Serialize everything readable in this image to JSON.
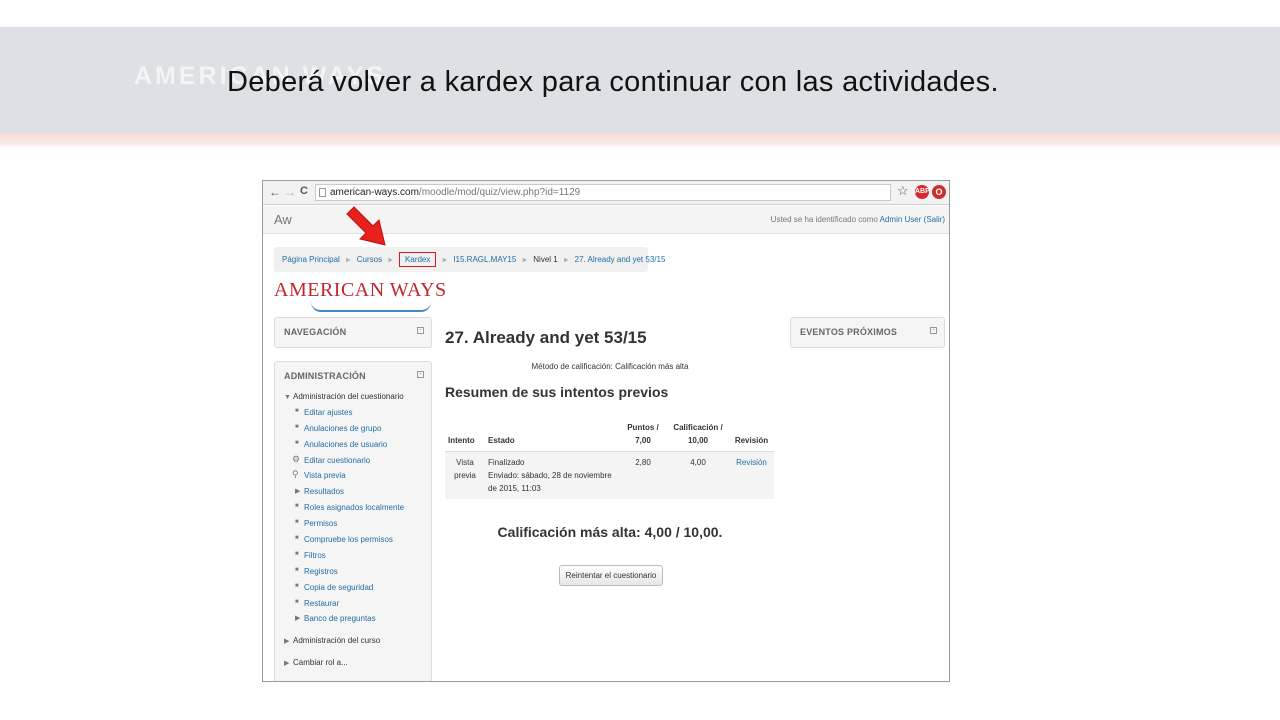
{
  "slide": {
    "title": "Deberá volver a kardex para continuar con las actividades.",
    "logo_text": "AMERICAN WAYS"
  },
  "browser": {
    "back_icon": "←",
    "forward_icon": "→",
    "reload_icon": "C",
    "url_host": "american-ways.com",
    "url_path": "/moodle/mod/quiz/view.php?id=1129",
    "star_icon": "☆",
    "abp_label": "ABP"
  },
  "site": {
    "brand": "Aw",
    "login_text": "Usted se ha identificado como ",
    "login_user": "Admin User",
    "logout": "(Salir)",
    "logo": "AMERICAN WAYS"
  },
  "breadcrumb": {
    "items": [
      "Página Principal",
      "Cursos",
      "Kardex",
      "I15.RAGL.MAY15",
      "Nivel 1",
      "27. Already and yet 53/15"
    ],
    "separator": "►"
  },
  "navigation": {
    "heading": "NAVEGACIÓN"
  },
  "events": {
    "heading": "EVENTOS PRÓXIMOS"
  },
  "administration": {
    "heading": "ADMINISTRACIÓN",
    "group_label": "Administración del cuestionario",
    "items": [
      "Editar ajustes",
      "Anulaciones de grupo",
      "Anulaciones de usuario",
      "Editar cuestionario",
      "Vista previa",
      "Resultados",
      "Roles asignados localmente",
      "Permisos",
      "Compruebe los permisos",
      "Filtros",
      "Registros",
      "Copia de seguridad",
      "Restaurar",
      "Banco de preguntas"
    ],
    "course_admin": "Administración del curso",
    "switch_role": "Cambiar rol a..."
  },
  "quiz": {
    "title": "27. Already and yet 53/15",
    "grading_method": "Método de calificación: Calificación más alta",
    "summary_title": "Resumen de sus intentos previos",
    "table": {
      "headers": [
        "Intento",
        "Estado",
        "Puntos / 7,00",
        "Calificación / 10,00",
        "Revisión"
      ],
      "row": {
        "attempt": "Vista previa",
        "state_title": "Finalizado",
        "state_detail": "Enviado: sábado, 28 de noviembre de 2015, 11:03",
        "points": "2,80",
        "grade": "4,00",
        "review": "Revisión"
      }
    },
    "best_grade": "Calificación más alta: 4,00 / 10,00.",
    "retry_button": "Reintentar el cuestionario"
  },
  "colors": {
    "link": "#1f6ea3",
    "highlight": "#d71920",
    "arrow": "#e8201e"
  }
}
